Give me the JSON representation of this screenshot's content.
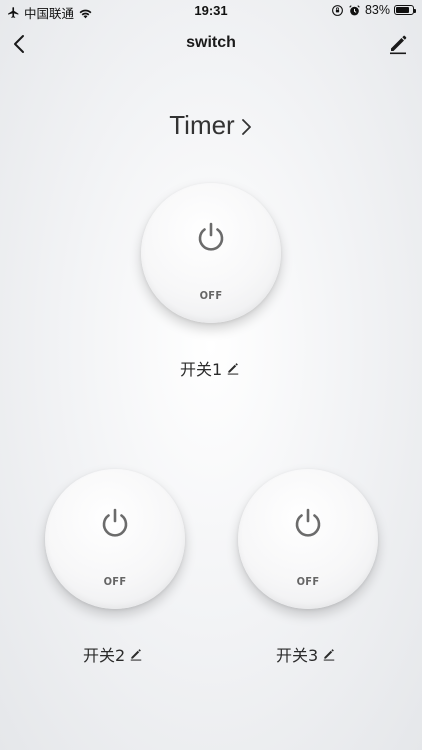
{
  "status_bar": {
    "carrier": "中国联通",
    "time": "19:31",
    "battery": "83%",
    "battery_level": 0.83,
    "icons": [
      "airplane-icon",
      "wifi-icon",
      "rotation-lock-icon",
      "alarm-icon",
      "battery-icon"
    ]
  },
  "nav": {
    "title": "switch",
    "back_icon": "chevron-left-icon",
    "edit_icon": "pencil-icon"
  },
  "timer": {
    "label": "Timer",
    "icon": "chevron-right-icon"
  },
  "switches": [
    {
      "name": "开关1",
      "state": "OFF"
    },
    {
      "name": "开关2",
      "state": "OFF"
    },
    {
      "name": "开关3",
      "state": "OFF"
    }
  ],
  "colors": {
    "icon_gray": "#6b6b6b",
    "text_dark": "#2b2b2b"
  }
}
